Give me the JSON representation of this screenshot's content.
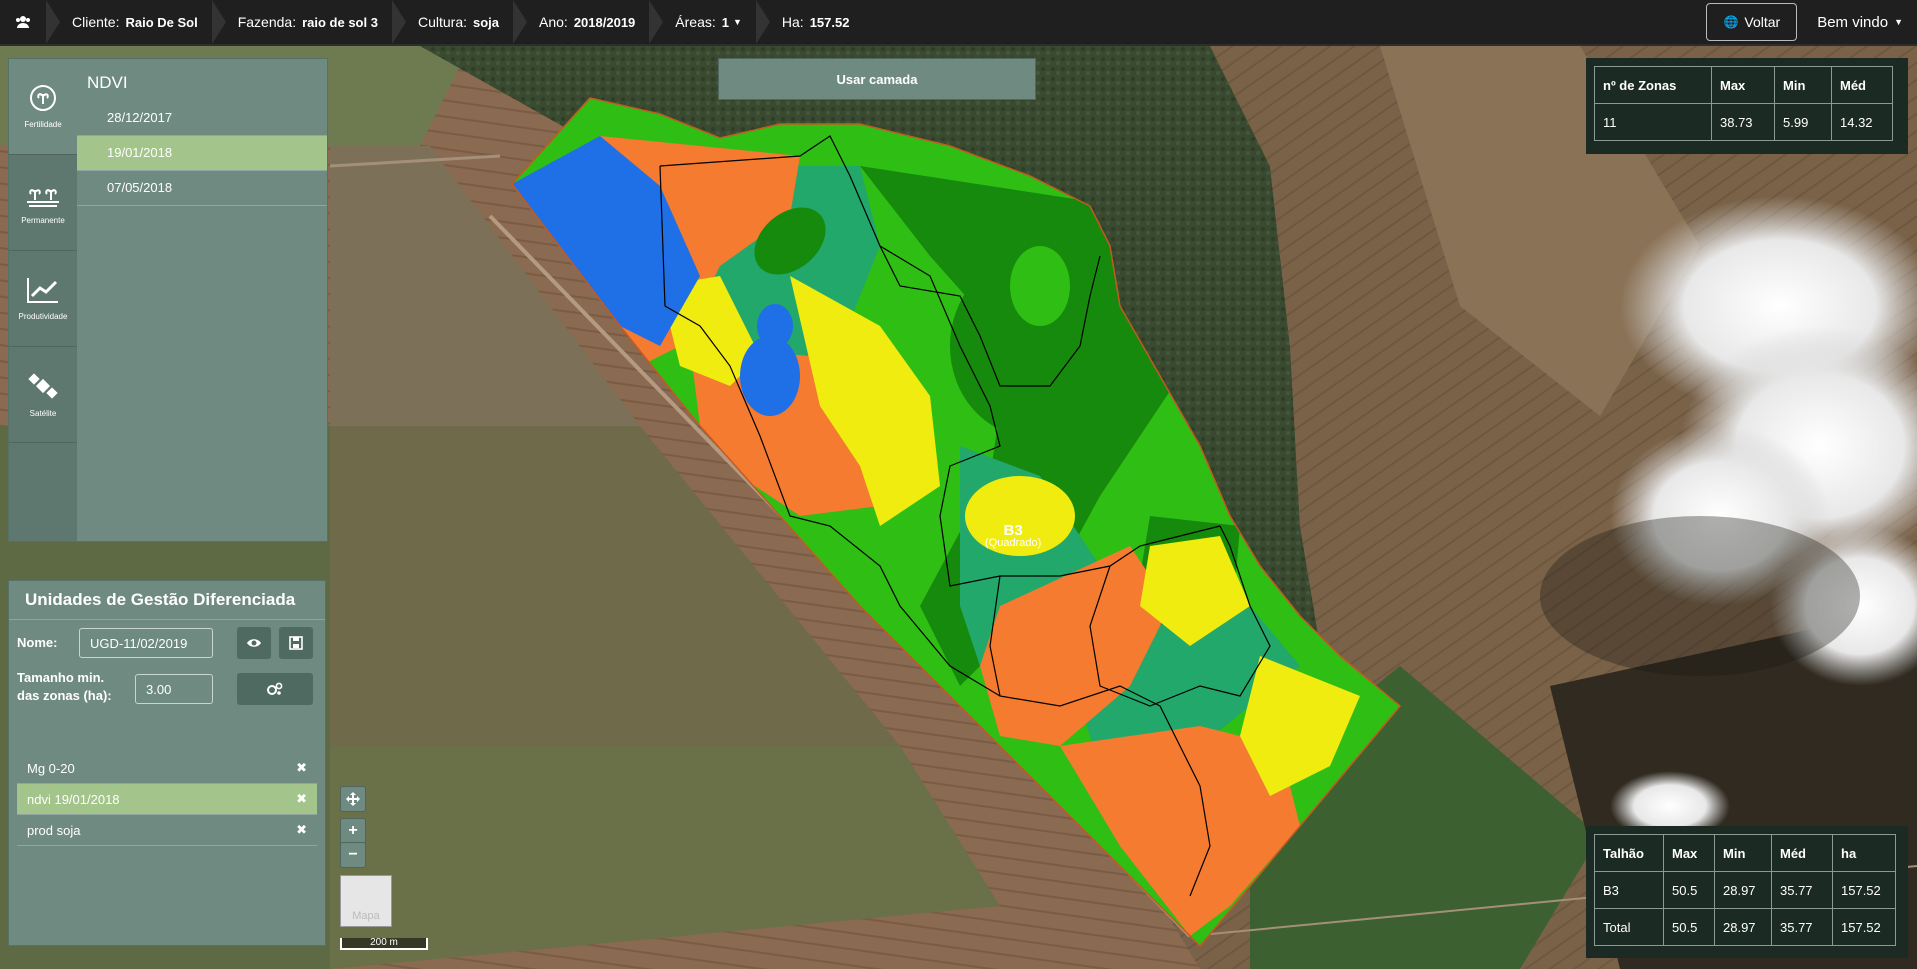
{
  "topbar": {
    "crumbs": [
      {
        "key": "Cliente:",
        "value": "Raio De Sol"
      },
      {
        "key": "Fazenda:",
        "value": "raio de sol 3"
      },
      {
        "key": "Cultura:",
        "value": "soja"
      },
      {
        "key": "Ano:",
        "value": "2018/2019"
      },
      {
        "key": "Áreas:",
        "value": "1"
      },
      {
        "key": "Ha:",
        "value": "157.52"
      }
    ],
    "voltar_label": "Voltar",
    "welcome_label": "Bem vindo"
  },
  "layer_panel": {
    "tabs": [
      {
        "label": "Fertilidade",
        "icon": "fertility-icon"
      },
      {
        "label": "Permanente",
        "icon": "permanent-icon"
      },
      {
        "label": "Produtividade",
        "icon": "productivity-chart-icon"
      },
      {
        "label": "Satélite",
        "icon": "satellite-icon"
      }
    ],
    "title": "NDVI",
    "dates": [
      "28/12/2017",
      "19/01/2018",
      "07/05/2018"
    ],
    "selected_date": "19/01/2018"
  },
  "use_layer_label": "Usar camada",
  "zone_stats": {
    "headers": [
      "nº de Zonas",
      "Max",
      "Min",
      "Méd"
    ],
    "row": [
      "11",
      "38.73",
      "5.99",
      "14.32"
    ]
  },
  "plot_stats": {
    "headers": [
      "Talhão",
      "Max",
      "Min",
      "Méd",
      "ha"
    ],
    "rows": [
      [
        "B3",
        "50.5",
        "28.97",
        "35.77",
        "157.52"
      ],
      [
        "Total",
        "50.5",
        "28.97",
        "35.77",
        "157.52"
      ]
    ]
  },
  "ugd": {
    "title": "Unidades de Gestão Diferenciada",
    "name_label": "Nome:",
    "name_value": "UGD-11/02/2019",
    "size_label_1": "Tamanho min.",
    "size_label_2": "das zonas (ha):",
    "size_value": "3.00",
    "items": [
      "Mg 0-20",
      "ndvi 19/01/2018",
      "prod soja"
    ],
    "selected_item": "ndvi 19/01/2018"
  },
  "map": {
    "plot_label": "B3",
    "plot_sublabel": "(Quadrado)",
    "scale_label": "200 m",
    "basemap_label": "Mapa"
  },
  "colors": {
    "panel": "#6f8a80",
    "selected": "#a3c48a",
    "ndvi_low": "#1f6fe6",
    "ndvi_mid_low": "#f47b30",
    "ndvi_mid": "#f0ec10",
    "ndvi_mid_high": "#21a86a",
    "ndvi_high": "#2fbe14",
    "ndvi_top": "#158a0c"
  }
}
